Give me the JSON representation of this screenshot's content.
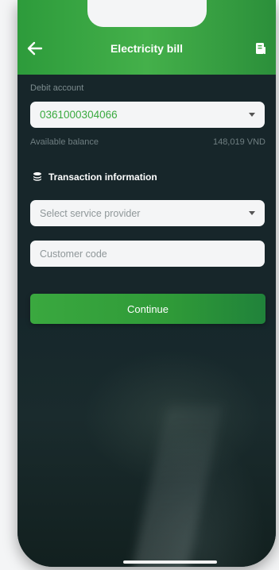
{
  "header": {
    "title": "Electricity bill",
    "back_icon": "arrow-left-icon",
    "right_icon": "document-icon",
    "color": "#3aa63f"
  },
  "debit": {
    "label": "Debit account",
    "account_number": "0361000304066",
    "available_label": "Available balance",
    "available_value": "148,019 VND",
    "accent": "#3aaa3f"
  },
  "transaction": {
    "section_title": "Transaction information",
    "section_icon": "coins-icon",
    "provider_placeholder": "Select service provider",
    "customer_code_placeholder": "Customer code"
  },
  "actions": {
    "continue_label": "Continue"
  }
}
